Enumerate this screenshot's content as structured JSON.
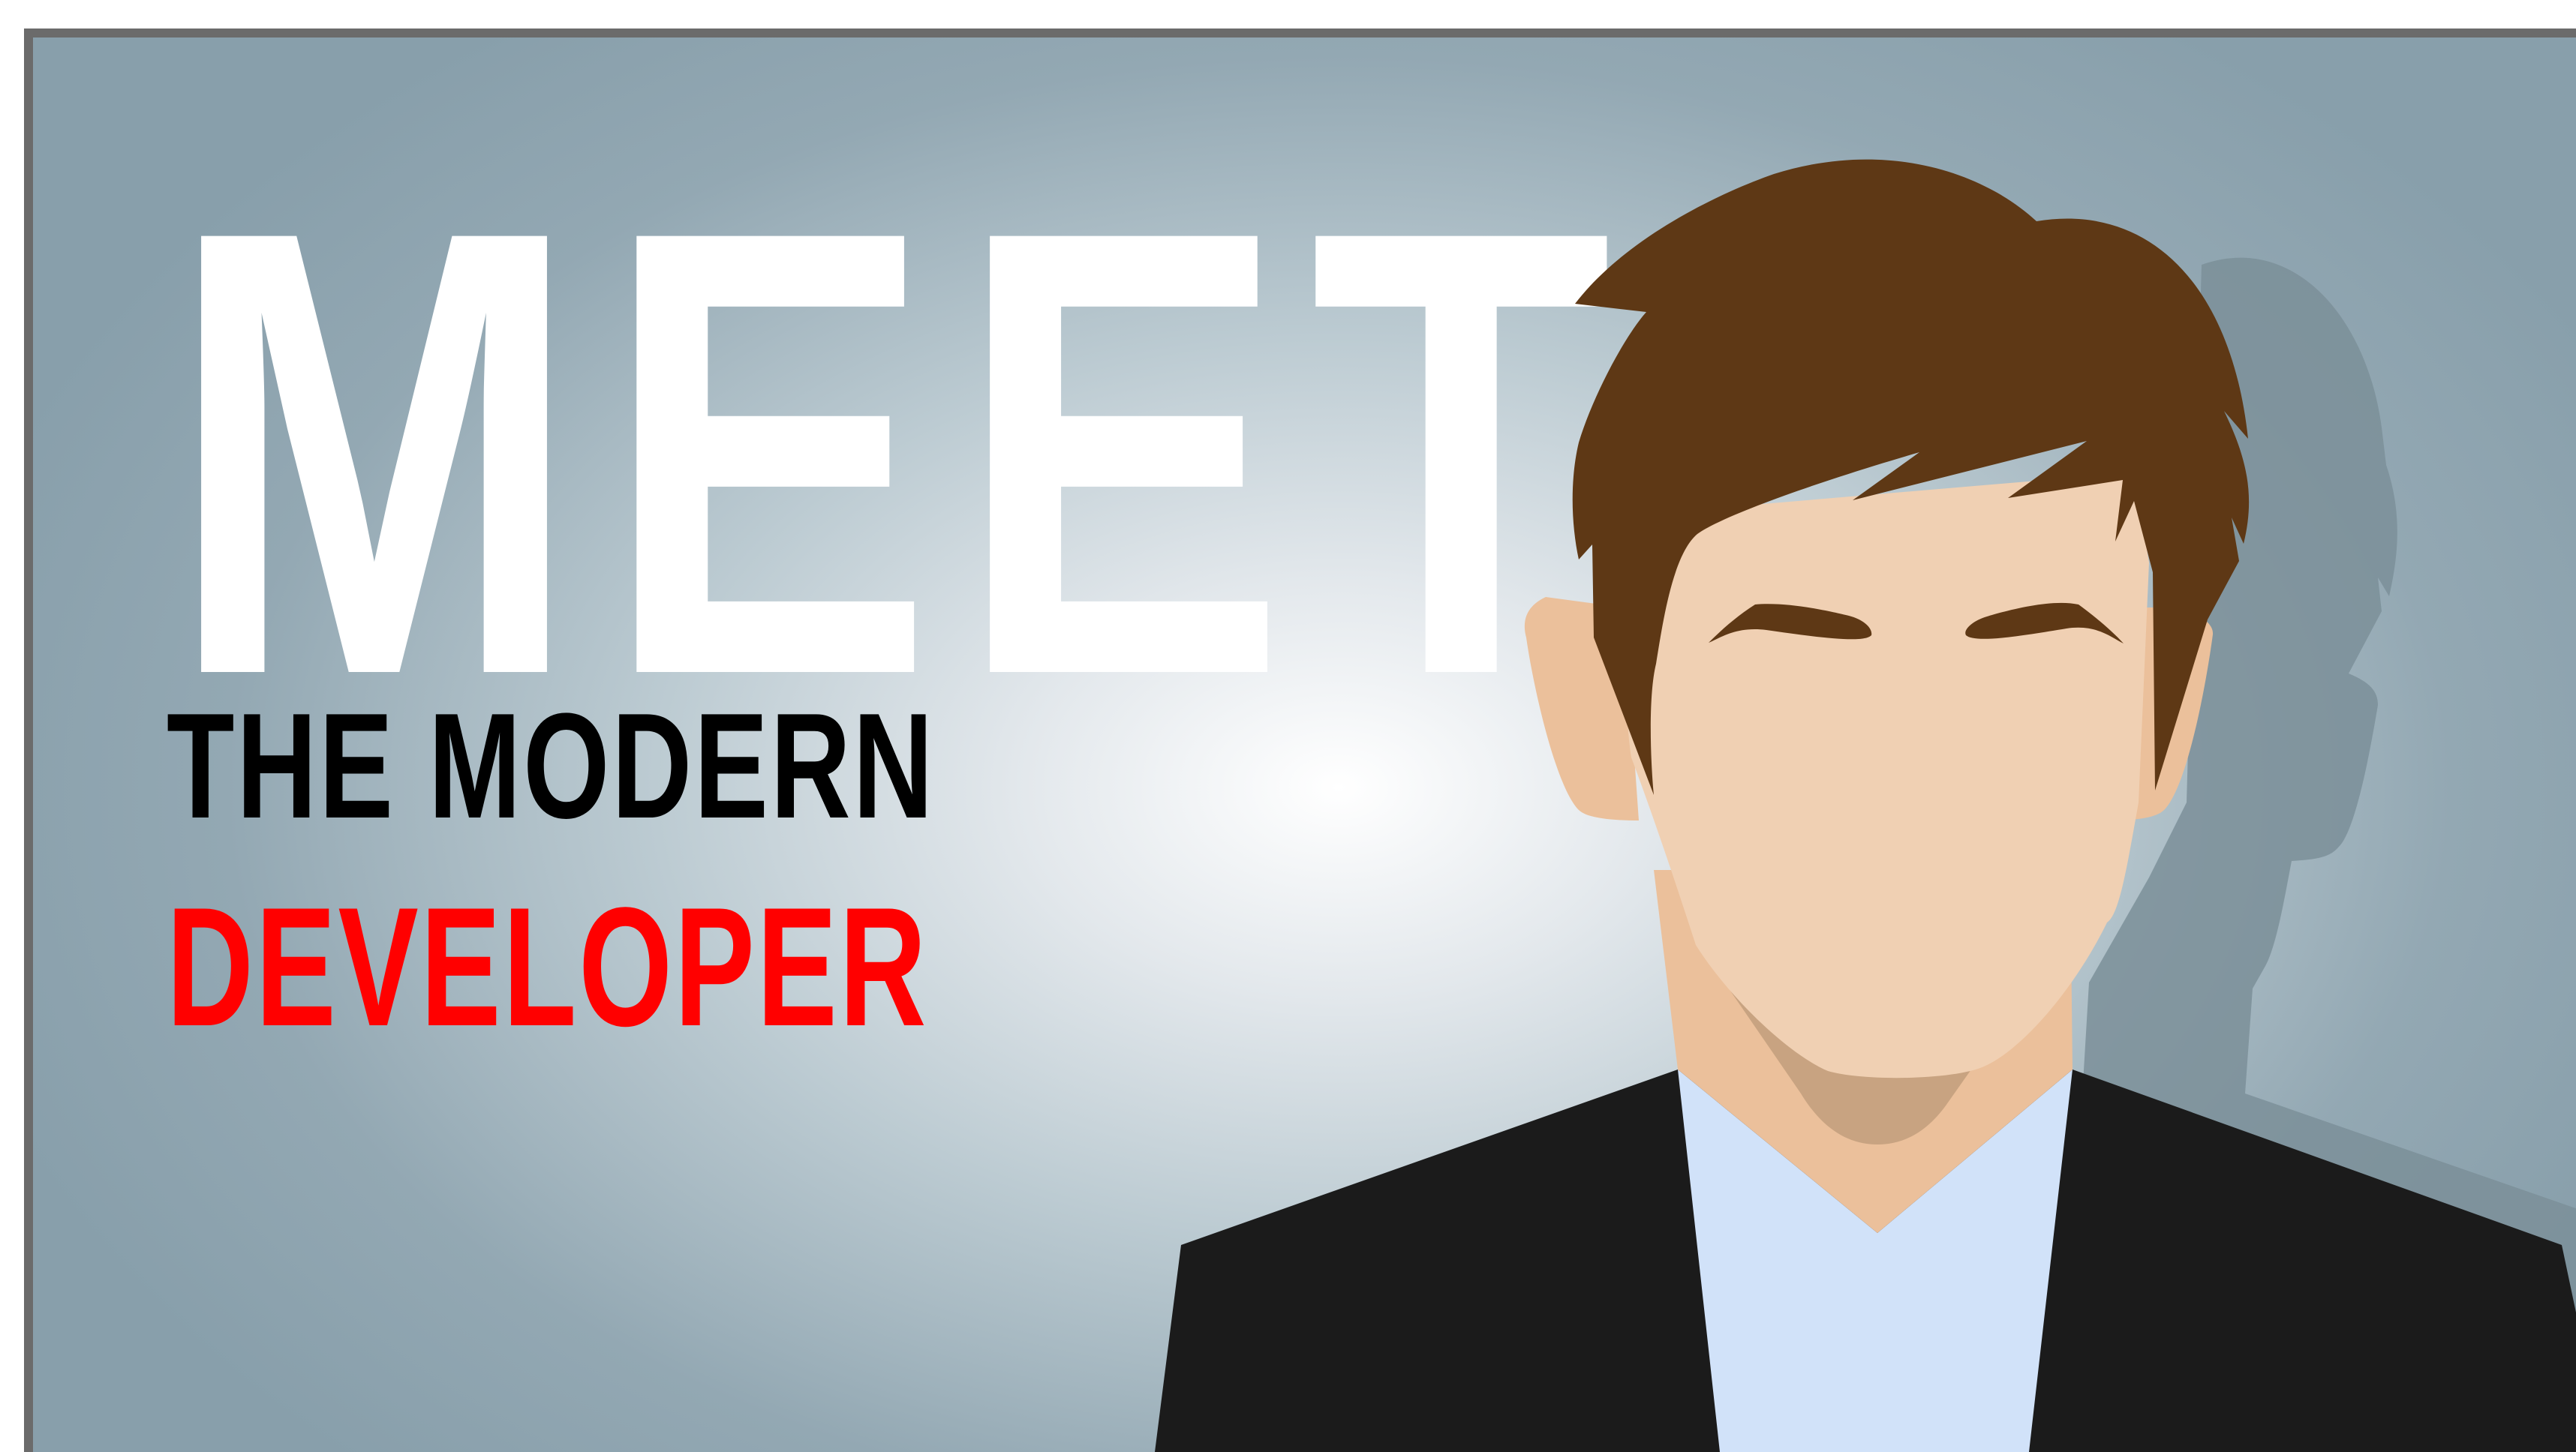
{
  "headline": {
    "word": "MEET",
    "line2": "THE MODERN",
    "line3": "DEVELOPER"
  },
  "icons": [
    "developer-avatar-illustration",
    "avatar-shadow"
  ],
  "colors": {
    "headline": "#ffffff",
    "line2": "#000000",
    "line3": "#ff0000",
    "frame_border": "#6b6b6b",
    "hair": "#5e3815",
    "skin": "#f0d0b3",
    "skin_shade": "#ebc09b",
    "neck_shadow": "#c8a381",
    "suit": "#1b1b1b",
    "shirt": "#d1e2f9",
    "shadow": "#7a8f98"
  }
}
